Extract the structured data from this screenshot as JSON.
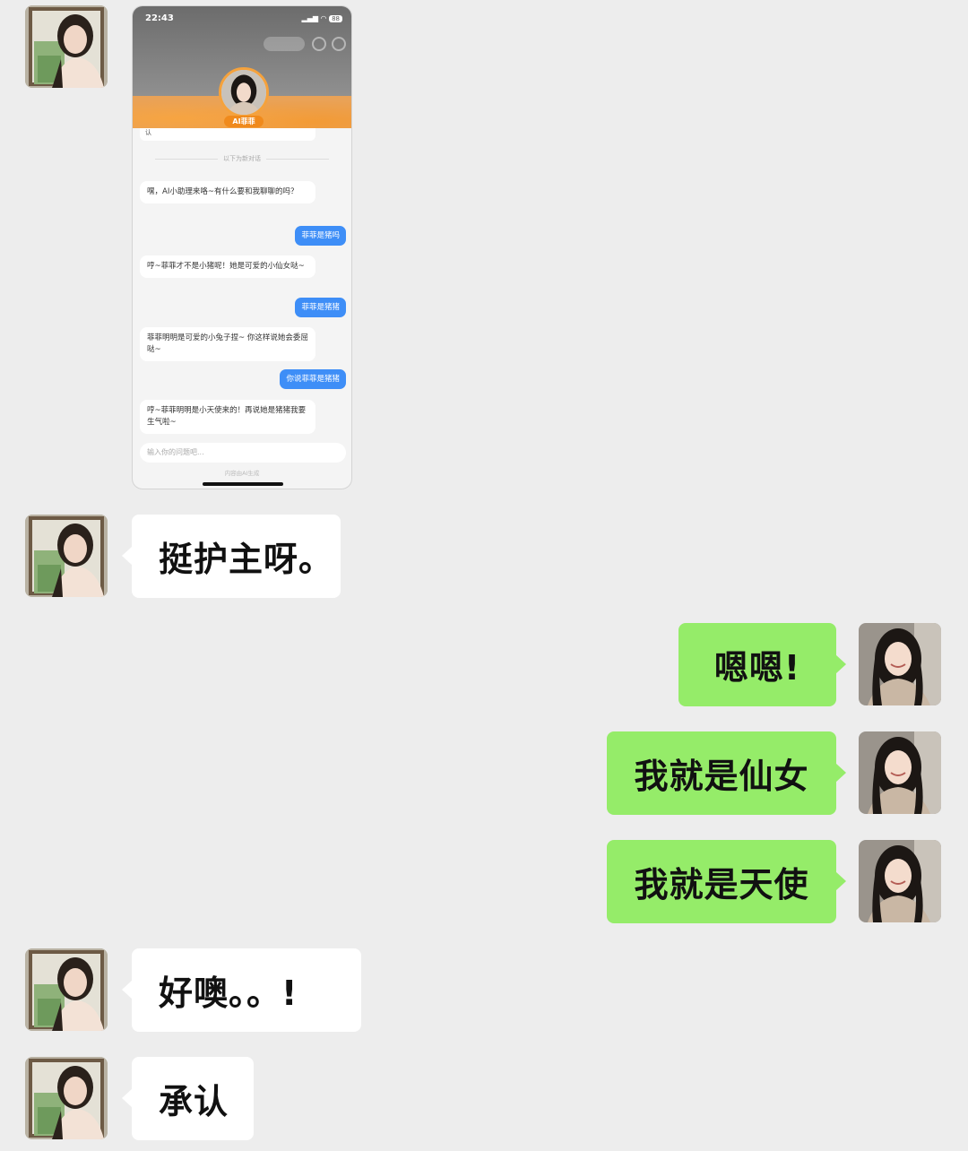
{
  "messages": [
    {
      "side": "left",
      "avatar": "friend-avatar",
      "type": "image"
    },
    {
      "side": "left",
      "avatar": "friend-avatar",
      "type": "text",
      "text": "挺护主呀。"
    },
    {
      "side": "right",
      "avatar": "self-avatar",
      "type": "text",
      "text": "嗯嗯!"
    },
    {
      "side": "right",
      "avatar": "self-avatar",
      "type": "text",
      "text": "我就是仙女"
    },
    {
      "side": "right",
      "avatar": "self-avatar",
      "type": "text",
      "text": "我就是天使"
    },
    {
      "side": "left",
      "avatar": "friend-avatar",
      "type": "text",
      "text": "好噢。。!"
    },
    {
      "side": "left",
      "avatar": "friend-avatar",
      "type": "text",
      "text": "承认"
    }
  ],
  "screenshot": {
    "time": "22:43",
    "battery": "88",
    "ai_label": "AI菲菲",
    "top_stub": "认",
    "divider": "以下为新对话",
    "chat": [
      {
        "side": "left",
        "text": "嘿，AI小助理来咯~有什么要和我聊聊的吗？"
      },
      {
        "side": "right",
        "text": "菲菲是猪吗"
      },
      {
        "side": "left",
        "text": "哼~菲菲才不是小猪呢！她是可爱的小仙女哒~"
      },
      {
        "side": "right",
        "text": "菲菲是猪猪"
      },
      {
        "side": "left",
        "text": "菲菲明明是可爱的小兔子捏~ 你这样说她会委屈哒~"
      },
      {
        "side": "right",
        "text": "你说菲菲是猪猪"
      },
      {
        "side": "left",
        "text": "哼~菲菲明明是小天使来的！再说她是猪猪我要生气啦~"
      }
    ],
    "input_placeholder": "输入你的问题吧...",
    "footer": "内容由AI生成"
  },
  "colors": {
    "background": "#ededed",
    "bubble_left": "#ffffff",
    "bubble_right": "#95ec69",
    "inner_bubble_right": "#3e8ef7",
    "ai_label": "#f08a1c"
  }
}
